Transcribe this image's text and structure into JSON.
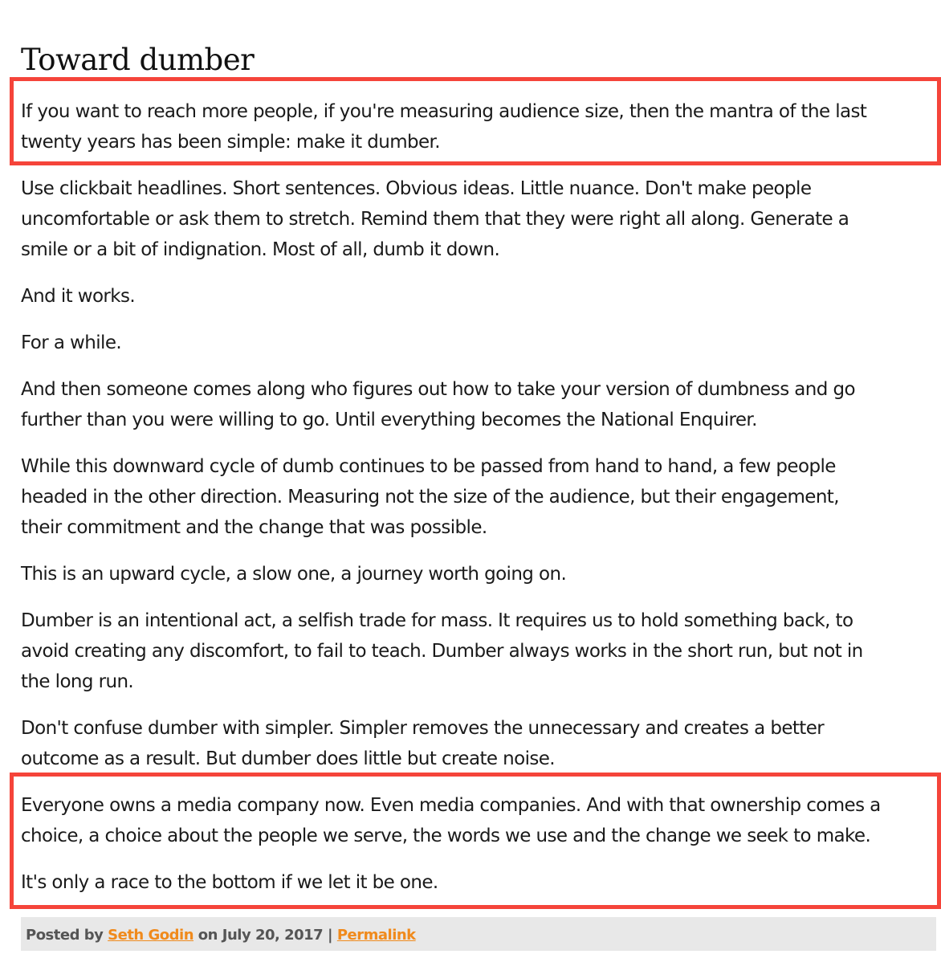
{
  "post": {
    "title": "Toward dumber",
    "paragraphs": [
      {
        "lines": [
          "If you want to reach more people, if you're measuring audience size, then the mantra of the last",
          "twenty years has been simple: make it dumber."
        ]
      },
      {
        "lines": [
          "Use clickbait headlines. Short sentences. Obvious ideas. Little nuance. Don't make people",
          "uncomfortable or ask them to stretch. Remind them that they were right all along. Generate a",
          "smile or a bit of indignation. Most of all, dumb it down."
        ]
      },
      {
        "lines": [
          "And it works."
        ]
      },
      {
        "lines": [
          "For a while."
        ]
      },
      {
        "lines": [
          "And then someone comes along who figures out how to take your version of dumbness and go",
          "further than you were willing to go. Until everything becomes the National Enquirer."
        ]
      },
      {
        "lines": [
          "While this downward cycle of dumb continues to be passed from hand to hand, a few people",
          "headed in the other direction. Measuring not the size of the audience, but their engagement,",
          "their commitment and the change that was possible."
        ]
      },
      {
        "lines": [
          "This is an upward cycle, a slow one, a journey worth going on."
        ]
      },
      {
        "lines": [
          "Dumber is an intentional act, a selfish trade for mass. It requires us to hold something back, to",
          "avoid creating any discomfort, to fail to teach. Dumber always works in the short run, but not in",
          "the long run."
        ]
      },
      {
        "lines": [
          "Don't confuse dumber with simpler. Simpler removes the unnecessary and creates a better",
          "outcome as a result. But dumber does little but create noise."
        ]
      },
      {
        "lines": [
          "Everyone owns a media company now. Even media companies. And with that ownership comes a",
          "choice, a choice about the people we serve, the words we use and the change we seek to make."
        ]
      },
      {
        "lines": [
          "It's only a race to the bottom if we let it be one."
        ]
      }
    ]
  },
  "footer": {
    "posted_by": "Posted by",
    "author": "Seth Godin",
    "on": "on",
    "date": "July 20, 2017",
    "separator": "|",
    "permalink": "Permalink"
  },
  "colors": {
    "highlight_border": "#f5443a",
    "link": "#f08a1c",
    "footer_bg": "#e8e8e8",
    "text": "#1a1a1a"
  }
}
